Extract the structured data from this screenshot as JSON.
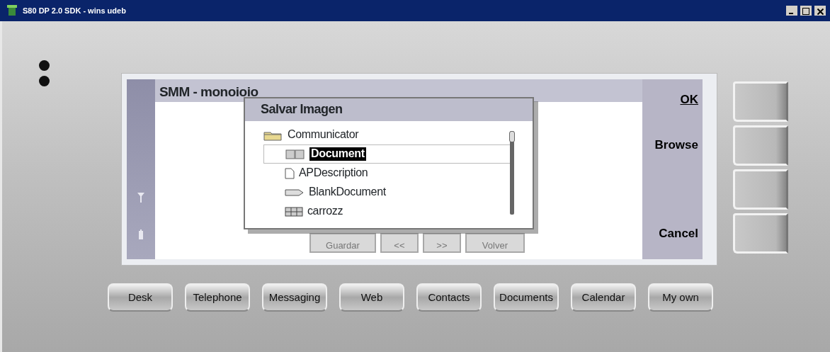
{
  "window": {
    "title": "S80 DP 2.0 SDK - wins udeb"
  },
  "app": {
    "title": "SMM - monoioio",
    "buttons": [
      {
        "label": "Guardar"
      },
      {
        "label": "<<"
      },
      {
        "label": ">>"
      },
      {
        "label": "Volver"
      }
    ]
  },
  "softkeys": [
    {
      "label": "OK",
      "default": true
    },
    {
      "label": "Browse",
      "default": false
    },
    {
      "label": "Cancel",
      "default": false
    }
  ],
  "dialog": {
    "title": "Salvar Imagen",
    "tree": [
      {
        "label": "Communicator",
        "kind": "folder",
        "children": [
          {
            "label": "Document",
            "kind": "templates",
            "selected": true
          },
          {
            "label": "APDescription",
            "kind": "page",
            "selected": false
          },
          {
            "label": "BlankDocument",
            "kind": "pen",
            "selected": false
          },
          {
            "label": "carrozz",
            "kind": "grid",
            "selected": false
          }
        ]
      }
    ]
  },
  "app_keys": [
    {
      "label": "Desk"
    },
    {
      "label": "Telephone"
    },
    {
      "label": "Messaging"
    },
    {
      "label": "Web"
    },
    {
      "label": "Contacts"
    },
    {
      "label": "Documents"
    },
    {
      "label": "Calendar"
    },
    {
      "label": "My own"
    }
  ]
}
